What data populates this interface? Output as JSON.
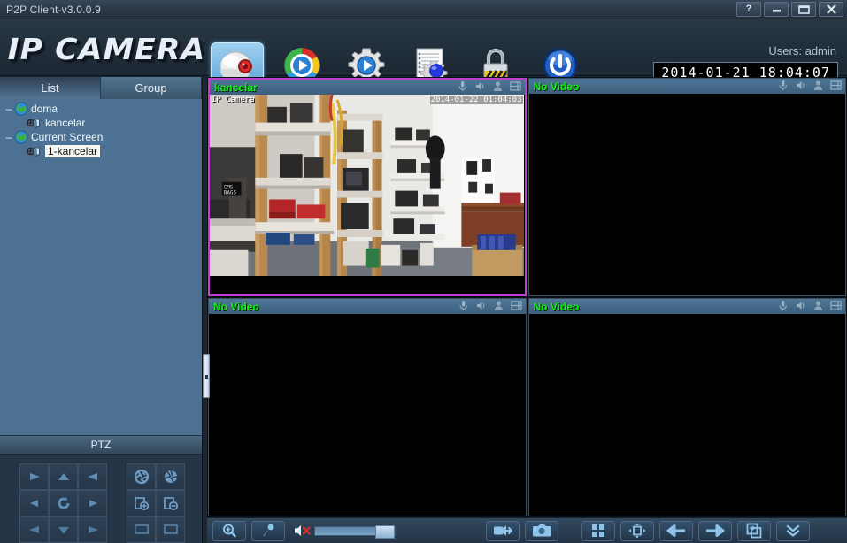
{
  "window": {
    "title": "P2P Client-v3.0.0.9",
    "buttons": [
      {
        "name": "help-button",
        "label": "?"
      },
      {
        "name": "minimize-button",
        "label": "–"
      },
      {
        "name": "maximize-button",
        "label": "▭"
      },
      {
        "name": "close-button",
        "label": "✕"
      }
    ]
  },
  "header": {
    "logo": "IP CAMERA",
    "users_label": "Users: admin",
    "clock": "2014-01-21 18:04:07",
    "toolbar": [
      {
        "name": "live-view-icon",
        "label": "Live View",
        "active": true
      },
      {
        "name": "playback-icon",
        "label": "Playback",
        "active": false
      },
      {
        "name": "settings-gear-icon",
        "label": "Settings",
        "active": false
      },
      {
        "name": "log-report-icon",
        "label": "Log",
        "active": false
      },
      {
        "name": "lock-icon",
        "label": "Lock",
        "active": false
      },
      {
        "name": "power-icon",
        "label": "Power",
        "active": false
      }
    ]
  },
  "sidebar": {
    "tabs": [
      {
        "name": "tab-list",
        "label": "List",
        "active": true
      },
      {
        "name": "tab-group",
        "label": "Group",
        "active": false
      }
    ],
    "tree": [
      {
        "name": "tree-node-doma",
        "label": "doma",
        "level": 0,
        "type": "group",
        "expander": "–",
        "selected": false
      },
      {
        "name": "tree-node-kancelar",
        "label": "kancelar",
        "level": 1,
        "type": "camera",
        "expander": "",
        "selected": false
      },
      {
        "name": "tree-node-current-screen",
        "label": "Current Screen",
        "level": 0,
        "type": "group",
        "expander": "–",
        "selected": false
      },
      {
        "name": "tree-node-1-kancelar",
        "label": "1-kancelar",
        "level": 1,
        "type": "camera",
        "expander": "",
        "selected": true
      }
    ],
    "ptz": {
      "title": "PTZ",
      "buttons": [
        {
          "name": "ptz-down-right-button",
          "icon": "triangle-down-right"
        },
        {
          "name": "ptz-up-button",
          "icon": "triangle-up"
        },
        {
          "name": "ptz-up-left-button",
          "icon": "triangle-up-left"
        },
        {
          "name": "ptz-left-button",
          "icon": "triangle-left"
        },
        {
          "name": "ptz-auto-scan-button",
          "icon": "rotate"
        },
        {
          "name": "ptz-right-button",
          "icon": "triangle-right"
        },
        {
          "name": "ptz-down-left-button",
          "icon": "triangle-down-left"
        },
        {
          "name": "ptz-down-button",
          "icon": "triangle-down"
        },
        {
          "name": "ptz-down-right2-button",
          "icon": "triangle-down-right"
        }
      ],
      "lens_buttons": [
        {
          "name": "ptz-iris-open-button",
          "icon": "iris-open"
        },
        {
          "name": "ptz-iris-close-button",
          "icon": "iris-close"
        },
        {
          "name": "ptz-zoom-in-button",
          "icon": "zoom-in"
        },
        {
          "name": "ptz-zoom-out-button",
          "icon": "zoom-out"
        },
        {
          "name": "ptz-focus-near-button",
          "icon": "focus-near"
        },
        {
          "name": "ptz-focus-far-button",
          "icon": "focus-far"
        }
      ]
    }
  },
  "video_panels": [
    {
      "name": "video-panel-1",
      "title": "kancelar",
      "active": true,
      "has_video": true,
      "overlay_left": "IP Camera",
      "overlay_right": "2014-01-22 01:04:03"
    },
    {
      "name": "video-panel-2",
      "title": "No Video",
      "active": false,
      "has_video": false
    },
    {
      "name": "video-panel-3",
      "title": "No Video",
      "active": false,
      "has_video": false
    },
    {
      "name": "video-panel-4",
      "title": "No Video",
      "active": false,
      "has_video": false
    }
  ],
  "panel_icons": [
    {
      "name": "microphone-icon"
    },
    {
      "name": "speaker-icon"
    },
    {
      "name": "person-icon"
    },
    {
      "name": "layout-icon"
    }
  ],
  "bottombar": {
    "left_buttons": [
      {
        "name": "zoom-search-button",
        "icon": "magnifier-plus"
      },
      {
        "name": "talk-microphone-button",
        "icon": "microphone"
      }
    ],
    "volume": {
      "name": "volume-slider",
      "muted": true,
      "value": 100
    },
    "mid_buttons": [
      {
        "name": "record-button",
        "icon": "record-camera"
      },
      {
        "name": "snapshot-button",
        "icon": "photo-camera"
      }
    ],
    "right_buttons": [
      {
        "name": "grid-layout-button",
        "icon": "grid-2x2"
      },
      {
        "name": "fullscreen-button",
        "icon": "fullscreen-arrows"
      },
      {
        "name": "previous-button",
        "icon": "arrow-left"
      },
      {
        "name": "next-button",
        "icon": "arrow-right"
      },
      {
        "name": "switch-stream-button",
        "icon": "swap-panels"
      },
      {
        "name": "expand-more-button",
        "icon": "chevron-double-down"
      }
    ]
  },
  "colors": {
    "accent_active_panel": "#c03fd0",
    "panel_title_text": "#12f012",
    "sidebar_bg": "#4d7192",
    "header_bg": "#22303d"
  }
}
